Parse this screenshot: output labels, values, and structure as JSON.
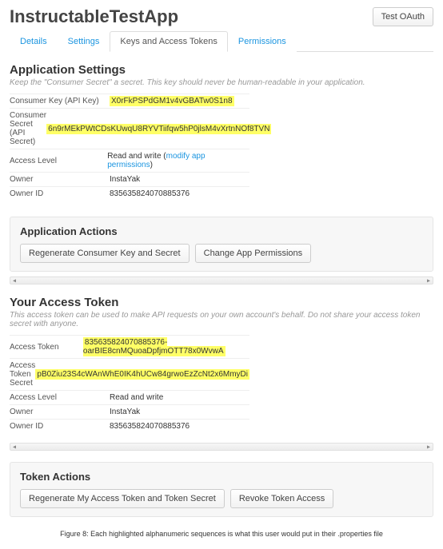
{
  "header": {
    "title": "InstructableTestApp",
    "test_oauth_btn": "Test OAuth"
  },
  "tabs": {
    "details": "Details",
    "settings": "Settings",
    "keys": "Keys and Access Tokens",
    "permissions": "Permissions"
  },
  "app_settings": {
    "heading": "Application Settings",
    "desc": "Keep the \"Consumer Secret\" a secret. This key should never be human-readable in your application.",
    "consumer_key_label": "Consumer Key (API Key)",
    "consumer_key_value": "X0rFkPSPdGM1v4vGBATw0S1n8",
    "consumer_secret_label": "Consumer Secret (API Secret)",
    "consumer_secret_value": "6n9rMEkPWtCDsKUwqU8RYVTiifqw5hP0jlsM4vXrtnNOf8TVN",
    "access_level_label": "Access Level",
    "access_level_value": "Read and write",
    "modify_permissions_link": "modify app permissions",
    "owner_label": "Owner",
    "owner_value": "InstaYak",
    "owner_id_label": "Owner ID",
    "owner_id_value": "835635824070885376"
  },
  "app_actions": {
    "heading": "Application Actions",
    "regenerate_btn": "Regenerate Consumer Key and Secret",
    "change_perms_btn": "Change App Permissions"
  },
  "access_token": {
    "heading": "Your Access Token",
    "desc": "This access token can be used to make API requests on your own account's behalf. Do not share your access token secret with anyone.",
    "token_label": "Access Token",
    "token_value": "835635824070885376-oarBIE8cnMQuoaDpfjmOTT78x0WvwA",
    "secret_label": "Access Token Secret",
    "secret_value": "pB0Ziu23S4cWAnWhE0IK4hUCw84grwoEzZcNt2x6MmyDi",
    "access_level_label": "Access Level",
    "access_level_value": "Read and write",
    "owner_label": "Owner",
    "owner_value": "InstaYak",
    "owner_id_label": "Owner ID",
    "owner_id_value": "835635824070885376"
  },
  "token_actions": {
    "heading": "Token Actions",
    "regenerate_btn": "Regenerate My Access Token and Token Secret",
    "revoke_btn": "Revoke Token Access"
  },
  "caption": "Figure 8: Each highlighted alphanumeric sequences is what this user would put in their .properties file"
}
